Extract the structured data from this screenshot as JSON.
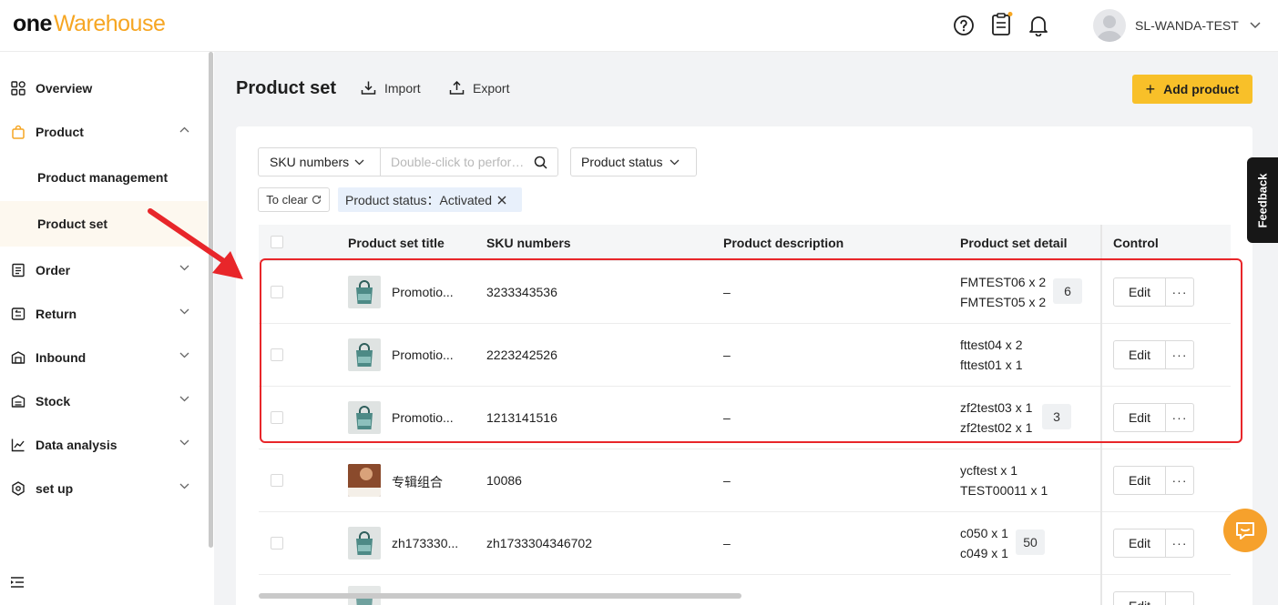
{
  "brand": {
    "one": "one",
    "warehouse": "Warehouse"
  },
  "header": {
    "username": "SL-WANDA-TEST",
    "icons": [
      "help-icon",
      "clipboard-icon",
      "bell-icon",
      "avatar",
      "chevron-down-icon"
    ]
  },
  "sidebar": {
    "items": [
      {
        "label": "Overview",
        "icon": "grid-icon"
      },
      {
        "label": "Product",
        "icon": "bag-icon",
        "expanded": true
      },
      {
        "label": "Product management"
      },
      {
        "label": "Product set",
        "active": true
      },
      {
        "label": "Order",
        "icon": "order-icon"
      },
      {
        "label": "Return",
        "icon": "return-icon"
      },
      {
        "label": "Inbound",
        "icon": "inbound-icon"
      },
      {
        "label": "Stock",
        "icon": "stock-icon"
      },
      {
        "label": "Data analysis",
        "icon": "chart-icon"
      },
      {
        "label": "set up",
        "icon": "settings-icon"
      }
    ]
  },
  "page": {
    "title": "Product set",
    "import_label": "Import",
    "export_label": "Export",
    "add_label": "Add product"
  },
  "filters": {
    "sku_select": "SKU numbers",
    "search_placeholder": "Double-click to perform batch search",
    "status_select": "Product status",
    "clear_label": "To clear",
    "active_tag": "Product status：Activated"
  },
  "table": {
    "columns": [
      "Product set title",
      "SKU numbers",
      "Product description",
      "Product set detail",
      "Control"
    ],
    "rows": [
      {
        "title": "Promotio...",
        "sku": "3233343536",
        "desc": "–",
        "detail1": "FMTEST06 x 2",
        "detail2": "FMTEST05 x 2",
        "count": "6",
        "edit": "Edit",
        "more": "···",
        "thumb": "bag"
      },
      {
        "title": "Promotio...",
        "sku": "2223242526",
        "desc": "–",
        "detail1": "fttest04 x 2",
        "detail2": "fttest01 x 1",
        "count": "",
        "edit": "Edit",
        "more": "···",
        "thumb": "bag"
      },
      {
        "title": "Promotio...",
        "sku": "1213141516",
        "desc": "–",
        "detail1": "zf2test03 x 1",
        "detail2": "zf2test02 x 1",
        "count": "3",
        "edit": "Edit",
        "more": "···",
        "thumb": "bag"
      },
      {
        "title": "专辑组合",
        "sku": "10086",
        "desc": "–",
        "detail1": "ycftest x 1",
        "detail2": "TEST00011 x 1",
        "count": "",
        "edit": "Edit",
        "more": "···",
        "thumb": "album"
      },
      {
        "title": "zh173330...",
        "sku": "zh1733304346702",
        "desc": "–",
        "detail1": "c050 x 1",
        "detail2": "c049 x 1",
        "count": "50",
        "edit": "Edit",
        "more": "···",
        "thumb": "bag"
      }
    ]
  },
  "feedback_label": "Feedback",
  "colors": {
    "accent": "#f8c029",
    "brand_orange": "#f6a623",
    "highlight_red": "#e8262a"
  }
}
